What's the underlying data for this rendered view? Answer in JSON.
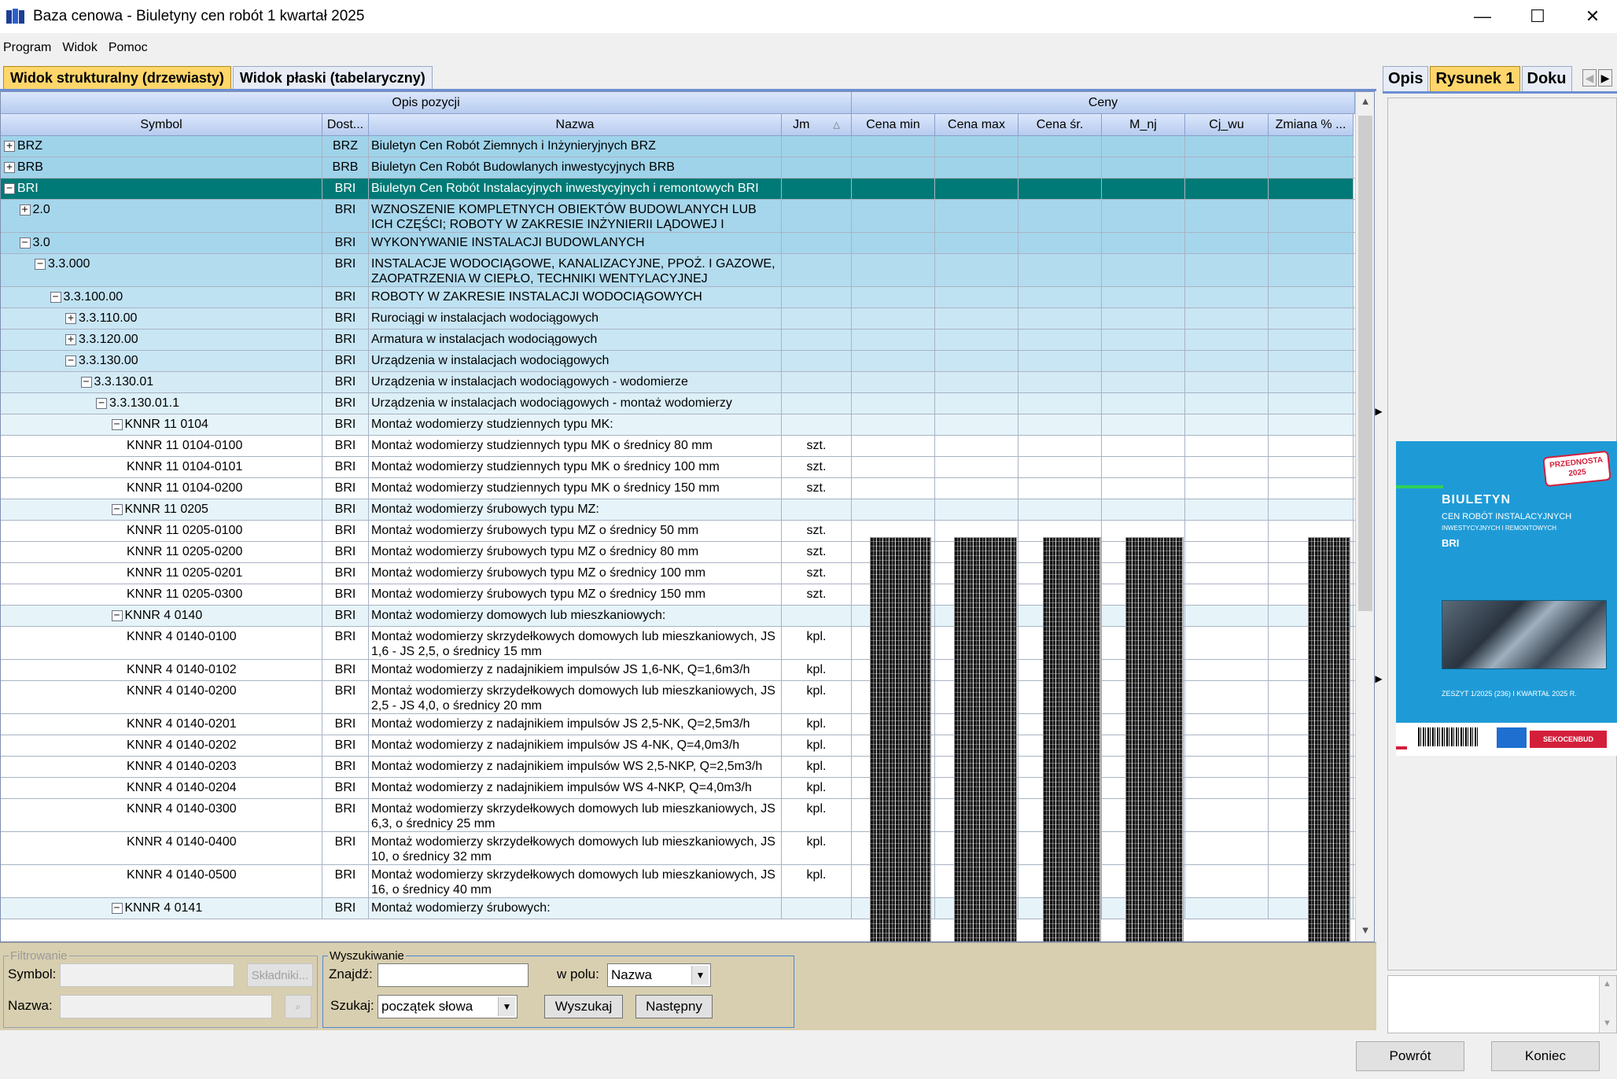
{
  "window": {
    "title": "Baza cenowa - Biuletyny cen robót 1 kwartał 2025",
    "minimize": "—",
    "maximize": "☐",
    "close": "✕"
  },
  "menu": [
    "Program",
    "Widok",
    "Pomoc"
  ],
  "tabs": [
    "Widok strukturalny (drzewiasty)",
    "Widok płaski (tabelaryczny)"
  ],
  "grid": {
    "group_headers": {
      "opis": "Opis pozycji",
      "ceny": "Ceny"
    },
    "columns": {
      "symbol": "Symbol",
      "dost": "Dost...",
      "nazwa": "Nazwa",
      "jm": "Jm",
      "cena_min": "Cena min",
      "cena_max": "Cena max",
      "cena_sr": "Cena śr.",
      "m_nj": "M_nj",
      "cj_wu": "Cj_wu",
      "zmiana": "Zmiana % ..."
    },
    "rows": [
      {
        "symbol": "BRZ",
        "indent": 0,
        "exp": "+",
        "dost": "BRZ",
        "name": "Biuletyn Cen Robót Ziemnych i Inżynieryjnych BRZ",
        "jm": "",
        "level": 0
      },
      {
        "symbol": "BRB",
        "indent": 0,
        "exp": "+",
        "dost": "BRB",
        "name": "Biuletyn Cen Robót Budowlanych inwestycyjnych BRB",
        "jm": "",
        "level": 0
      },
      {
        "symbol": "BRI",
        "indent": 0,
        "exp": "−",
        "dost": "BRI",
        "name": "Biuletyn Cen Robót Instalacyjnych inwestycyjnych i remontowych BRI",
        "jm": "",
        "level": 0,
        "selected": true
      },
      {
        "symbol": "2.0",
        "indent": 1,
        "exp": "+",
        "dost": "BRI",
        "name": "WZNOSZENIE KOMPLETNYCH OBIEKTÓW BUDOWLANYCH LUB ICH CZĘŚCI; ROBOTY W ZAKRESIE INŻYNIERII LĄDOWEJ I WODNEJ",
        "jm": "",
        "level": 1,
        "tall": true
      },
      {
        "symbol": "3.0",
        "indent": 1,
        "exp": "−",
        "dost": "BRI",
        "name": "WYKONYWANIE INSTALACJI BUDOWLANYCH",
        "jm": "",
        "level": 1
      },
      {
        "symbol": "3.3.000",
        "indent": 2,
        "exp": "−",
        "dost": "BRI",
        "name": "INSTALACJE WODOCIĄGOWE, KANALIZACYJNE, PPOŻ. I GAZOWE, ZAOPATRZENIA W CIEPŁO, TECHNIKI WENTYLACYJNEJ",
        "jm": "",
        "level": 2,
        "tall": true
      },
      {
        "symbol": "3.3.100.00",
        "indent": 3,
        "exp": "−",
        "dost": "BRI",
        "name": "ROBOTY W ZAKRESIE INSTALACJI WODOCIĄGOWYCH",
        "jm": "",
        "level": 3
      },
      {
        "symbol": "3.3.110.00",
        "indent": 4,
        "exp": "+",
        "dost": "BRI",
        "name": "Rurociągi w instalacjach wodociągowych",
        "jm": "",
        "level": 4
      },
      {
        "symbol": "3.3.120.00",
        "indent": 4,
        "exp": "+",
        "dost": "BRI",
        "name": "Armatura w instalacjach wodociągowych",
        "jm": "",
        "level": 4
      },
      {
        "symbol": "3.3.130.00",
        "indent": 4,
        "exp": "−",
        "dost": "BRI",
        "name": "Urządzenia w instalacjach wodociągowych",
        "jm": "",
        "level": 4
      },
      {
        "symbol": "3.3.130.01",
        "indent": 5,
        "exp": "−",
        "dost": "BRI",
        "name": "Urządzenia w instalacjach wodociągowych - wodomierze",
        "jm": "",
        "level": 5
      },
      {
        "symbol": "3.3.130.01.1",
        "indent": 6,
        "exp": "−",
        "dost": "BRI",
        "name": "Urządzenia w instalacjach wodociągowych - montaż wodomierzy",
        "jm": "",
        "level": 6
      },
      {
        "symbol": "KNNR 11 0104",
        "indent": 7,
        "exp": "−",
        "dost": "BRI",
        "name": "Montaż wodomierzy studziennych typu MK:",
        "jm": "",
        "level": 7
      },
      {
        "symbol": "KNNR 11 0104-0100",
        "indent": 8,
        "exp": "",
        "dost": "BRI",
        "name": "Montaż wodomierzy studziennych typu MK o średnicy 80 mm",
        "jm": "szt.",
        "level": 8
      },
      {
        "symbol": "KNNR 11 0104-0101",
        "indent": 8,
        "exp": "",
        "dost": "BRI",
        "name": "Montaż wodomierzy studziennych typu MK o średnicy 100 mm",
        "jm": "szt.",
        "level": 8
      },
      {
        "symbol": "KNNR 11 0104-0200",
        "indent": 8,
        "exp": "",
        "dost": "BRI",
        "name": "Montaż wodomierzy studziennych typu MK o średnicy 150 mm",
        "jm": "szt.",
        "level": 8
      },
      {
        "symbol": "KNNR 11 0205",
        "indent": 7,
        "exp": "−",
        "dost": "BRI",
        "name": "Montaż wodomierzy śrubowych typu MZ:",
        "jm": "",
        "level": 7
      },
      {
        "symbol": "KNNR 11 0205-0100",
        "indent": 8,
        "exp": "",
        "dost": "BRI",
        "name": "Montaż wodomierzy śrubowych typu MZ o średnicy 50 mm",
        "jm": "szt.",
        "level": 8
      },
      {
        "symbol": "KNNR 11 0205-0200",
        "indent": 8,
        "exp": "",
        "dost": "BRI",
        "name": "Montaż wodomierzy śrubowych typu MZ o średnicy 80 mm",
        "jm": "szt.",
        "level": 8
      },
      {
        "symbol": "KNNR 11 0205-0201",
        "indent": 8,
        "exp": "",
        "dost": "BRI",
        "name": "Montaż wodomierzy śrubowych typu MZ o średnicy 100 mm",
        "jm": "szt.",
        "level": 8
      },
      {
        "symbol": "KNNR 11 0205-0300",
        "indent": 8,
        "exp": "",
        "dost": "BRI",
        "name": "Montaż wodomierzy śrubowych typu MZ o średnicy 150 mm",
        "jm": "szt.",
        "level": 8
      },
      {
        "symbol": "KNNR 4 0140",
        "indent": 7,
        "exp": "−",
        "dost": "BRI",
        "name": "Montaż wodomierzy domowych lub mieszkaniowych:",
        "jm": "",
        "level": 7
      },
      {
        "symbol": "KNNR 4 0140-0100",
        "indent": 8,
        "exp": "",
        "dost": "BRI",
        "name": "Montaż wodomierzy skrzydełkowych domowych lub mieszkaniowych, JS 1,6 - JS 2,5, o średnicy 15 mm",
        "jm": "kpl.",
        "level": 8,
        "tall": true
      },
      {
        "symbol": "KNNR 4 0140-0102",
        "indent": 8,
        "exp": "",
        "dost": "BRI",
        "name": "Montaż wodomierzy z nadajnikiem impulsów JS 1,6-NK, Q=1,6m3/h",
        "jm": "kpl.",
        "level": 8
      },
      {
        "symbol": "KNNR 4 0140-0200",
        "indent": 8,
        "exp": "",
        "dost": "BRI",
        "name": "Montaż wodomierzy skrzydełkowych domowych lub mieszkaniowych, JS 2,5 - JS 4,0, o średnicy 20 mm",
        "jm": "kpl.",
        "level": 8,
        "tall": true
      },
      {
        "symbol": "KNNR 4 0140-0201",
        "indent": 8,
        "exp": "",
        "dost": "BRI",
        "name": "Montaż wodomierzy z nadajnikiem impulsów JS 2,5-NK, Q=2,5m3/h",
        "jm": "kpl.",
        "level": 8
      },
      {
        "symbol": "KNNR 4 0140-0202",
        "indent": 8,
        "exp": "",
        "dost": "BRI",
        "name": "Montaż wodomierzy z nadajnikiem impulsów JS 4-NK, Q=4,0m3/h",
        "jm": "kpl.",
        "level": 8
      },
      {
        "symbol": "KNNR 4 0140-0203",
        "indent": 8,
        "exp": "",
        "dost": "BRI",
        "name": "Montaż wodomierzy z nadajnikiem impulsów WS 2,5-NKP, Q=2,5m3/h",
        "jm": "kpl.",
        "level": 8
      },
      {
        "symbol": "KNNR 4 0140-0204",
        "indent": 8,
        "exp": "",
        "dost": "BRI",
        "name": "Montaż wodomierzy z nadajnikiem impulsów WS 4-NKP, Q=4,0m3/h",
        "jm": "kpl.",
        "level": 8
      },
      {
        "symbol": "KNNR 4 0140-0300",
        "indent": 8,
        "exp": "",
        "dost": "BRI",
        "name": "Montaż wodomierzy skrzydełkowych domowych lub mieszkaniowych, JS 6,3, o średnicy 25 mm",
        "jm": "kpl.",
        "level": 8,
        "tall": true
      },
      {
        "symbol": "KNNR 4 0140-0400",
        "indent": 8,
        "exp": "",
        "dost": "BRI",
        "name": "Montaż wodomierzy skrzydełkowych domowych lub mieszkaniowych, JS 10, o średnicy 32 mm",
        "jm": "kpl.",
        "level": 8,
        "tall": true
      },
      {
        "symbol": "KNNR 4 0140-0500",
        "indent": 8,
        "exp": "",
        "dost": "BRI",
        "name": "Montaż wodomierzy skrzydełkowych domowych lub mieszkaniowych, JS 16, o średnicy 40 mm",
        "jm": "kpl.",
        "level": 8,
        "tall": true
      },
      {
        "symbol": "KNNR 4 0141",
        "indent": 7,
        "exp": "−",
        "dost": "BRI",
        "name": "Montaż wodomierzy śrubowych:",
        "jm": "",
        "level": 7
      }
    ]
  },
  "filter": {
    "legend": "Filtrowanie",
    "symbol_label": "Symbol:",
    "symbol_value": "",
    "skladniki": "Składniki...",
    "nazwa_label": "Nazwa:",
    "nazwa_value": ""
  },
  "search": {
    "legend": "Wyszukiwanie",
    "find_label": "Znajdź:",
    "find_value": "",
    "field_label": "w polu:",
    "field_value": "Nazwa",
    "mode_label": "Szukaj:",
    "mode_value": "początek słowa",
    "search_btn": "Wyszukaj",
    "next_btn": "Następny"
  },
  "footer": {
    "back": "Powrót",
    "end": "Koniec"
  },
  "right_tabs": [
    "Opis",
    "Rysunek 1",
    "Doku"
  ],
  "cover": {
    "badge": "PRZEDNOSTA 2025",
    "title": "BIULETYN",
    "subtitle": "CEN ROBÓT INSTALACYJNYCH",
    "subtitle2": "INWESTYCYJNYCH I REMONTOWYCH",
    "code": "BRI",
    "issue": "ZESZYT 1/2025 (236)     I KWARTAŁ 2025 R.",
    "brand": "SEKOCENBUD"
  },
  "colors": {
    "selected": "#007a76",
    "tab_active": "#ffd66b",
    "bottom_panel": "#d8cfb0",
    "cover_blue": "#1e9bd7"
  }
}
